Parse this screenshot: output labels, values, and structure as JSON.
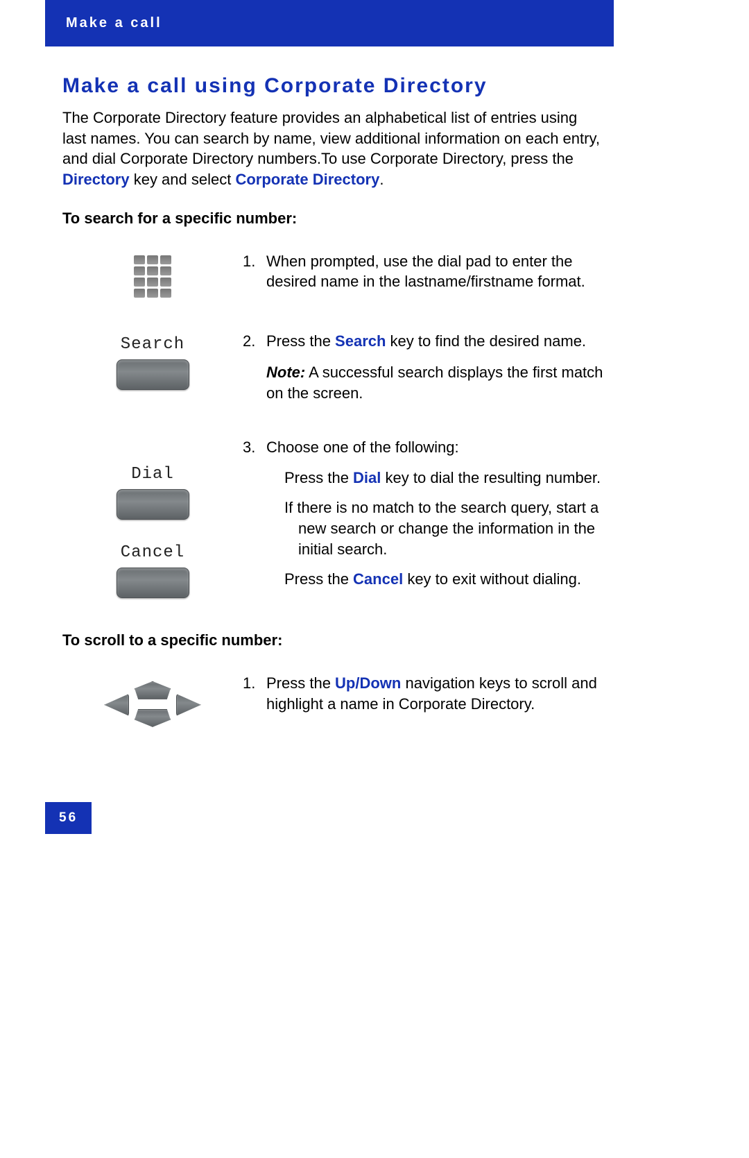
{
  "header": {
    "breadcrumb": "Make a call"
  },
  "title": "Make a call using Corporate Directory",
  "intro": {
    "pre": "The Corporate Directory feature provides an alphabetical list of entries using last names. You can search by name, view additional information on each entry, and dial Corporate Directory numbers.To use Corporate Directory, press the ",
    "k1": "Directory",
    "mid": " key and select ",
    "k2": "Corporate Directory",
    "post": "."
  },
  "section1": {
    "heading": "To search for a specific number:",
    "steps": [
      {
        "num": "1.",
        "text": "When prompted, use the dial pad to enter the desired name in the lastname/firstname format."
      },
      {
        "num": "2.",
        "pre": "Press the ",
        "key": "Search",
        "post": " key to find the desired name.",
        "noteLabel": "Note:",
        "noteText": " A successful search displays the first match on the screen.",
        "btn": "Search"
      },
      {
        "num": "3.",
        "lead": "Choose one of the following:",
        "a_pre": "Press the   ",
        "a_key": "Dial",
        "a_post": " key to dial the resulting number.",
        "b": "If there is no match to the search query, start a new search or change the information in the initial search.",
        "c_pre": "Press the   ",
        "c_key": "Cancel",
        "c_post": " key to exit without dialing.",
        "btn1": "Dial",
        "btn2": "Cancel"
      }
    ]
  },
  "section2": {
    "heading": "To scroll to a specific number:",
    "step": {
      "num": "1.",
      "pre": "Press the ",
      "key": "Up/Down",
      "post": " navigation keys to scroll and highlight a name in Corporate Directory."
    }
  },
  "page": "56"
}
